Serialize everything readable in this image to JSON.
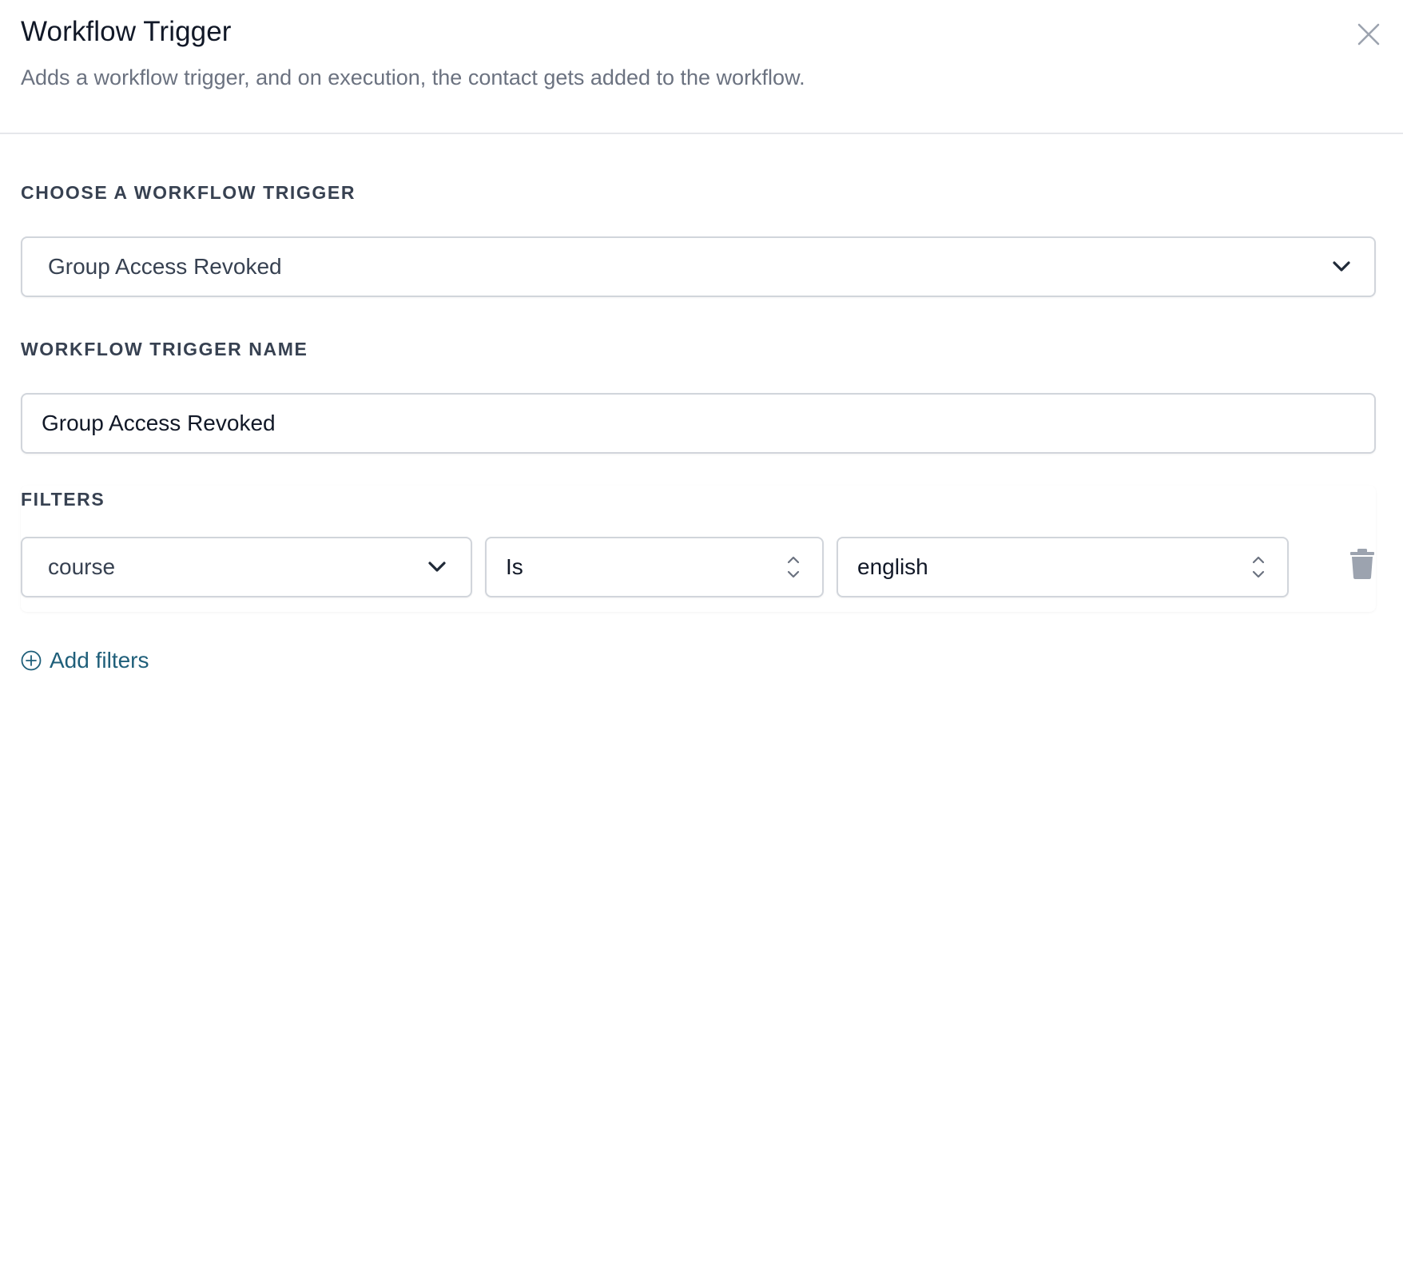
{
  "header": {
    "title": "Workflow Trigger",
    "subtitle": "Adds a workflow trigger, and on execution, the contact gets added to the workflow.",
    "close_icon": "close-icon"
  },
  "trigger_select": {
    "label": "CHOOSE A WORKFLOW TRIGGER",
    "value": "Group Access Revoked",
    "icon": "chevron-down-icon"
  },
  "trigger_name": {
    "label": "WORKFLOW TRIGGER NAME",
    "value": "Group Access Revoked"
  },
  "filters": {
    "label": "FILTERS",
    "rows": [
      {
        "field": "course",
        "operator": "Is",
        "value": "english",
        "delete_icon": "trash-icon"
      }
    ],
    "add_label": "Add filters",
    "add_icon": "plus-circle-icon"
  },
  "colors": {
    "title": "#111827",
    "subtitle": "#6b7280",
    "label": "#374151",
    "border": "#d1d5db",
    "link": "#1f5f7a",
    "icon": "#9ca3af"
  }
}
